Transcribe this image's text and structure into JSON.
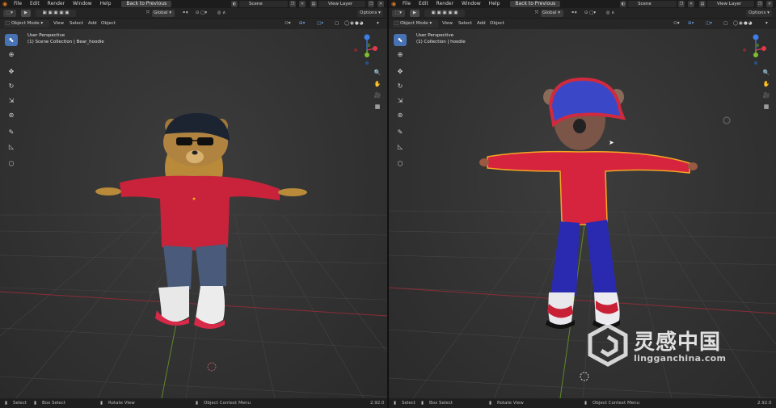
{
  "menu": {
    "file": "File",
    "edit": "Edit",
    "render": "Render",
    "window": "Window",
    "help": "Help",
    "back": "Back to Previous"
  },
  "fields": {
    "scene": "Scene",
    "view_layer": "View Layer"
  },
  "toolbar": {
    "orientation": "Global",
    "options": "Options"
  },
  "header": {
    "mode": "Object Mode",
    "view": "View",
    "select": "Select",
    "add": "Add",
    "object": "Object"
  },
  "left": {
    "vp_line1": "User Perspective",
    "vp_line2": "(1) Scene Collection | Bear_hoodie",
    "version": "2.92.0"
  },
  "right": {
    "vp_line1": "User Perspective",
    "vp_line2": "(1) Collection | hoodie",
    "version": "2.92.0"
  },
  "status": {
    "select": "Select",
    "box_select": "Box Select",
    "rotate": "Rotate View",
    "context": "Object Context Menu"
  },
  "watermark": {
    "title": "灵感中国",
    "url": "lingganchina.com"
  },
  "colors": {
    "accent": "#4772b3",
    "axis_x": "#e0394a",
    "axis_y": "#7fbf2f",
    "axis_z": "#3d7ee8",
    "select_outline": "#f5a623"
  }
}
